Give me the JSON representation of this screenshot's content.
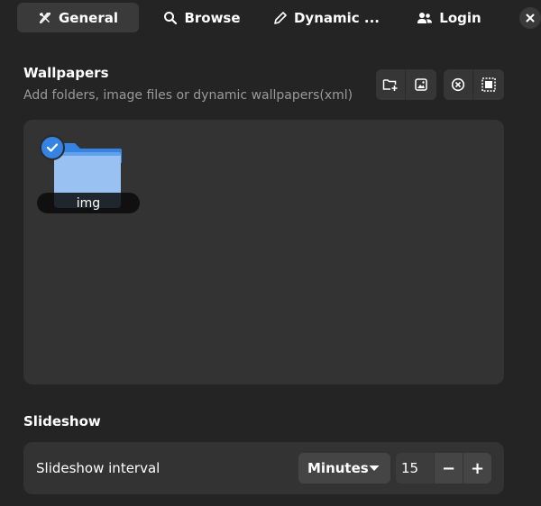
{
  "tabs": [
    {
      "label": "General",
      "icon": "tools-icon",
      "active": true
    },
    {
      "label": "Browse",
      "icon": "search-icon",
      "active": false
    },
    {
      "label": "Dynamic ...",
      "icon": "pencil-icon",
      "active": false
    },
    {
      "label": "Login",
      "icon": "users-icon",
      "active": false
    }
  ],
  "close_icon": "close-icon",
  "wallpapers": {
    "title": "Wallpapers",
    "subtitle": "Add folders, image files or dynamic wallpapers(xml)",
    "buttons": [
      "add-folder-icon",
      "add-image-icon",
      "remove-icon",
      "select-all-icon"
    ],
    "items": [
      {
        "label": "img",
        "selected": true
      }
    ]
  },
  "slideshow": {
    "title": "Slideshow",
    "interval_label": "Slideshow interval",
    "unit": "Minutes",
    "value": "15",
    "decrement": "−",
    "increment": "+"
  },
  "colors": {
    "accent": "#3584e4",
    "background": "#242424",
    "panel": "#333333"
  }
}
